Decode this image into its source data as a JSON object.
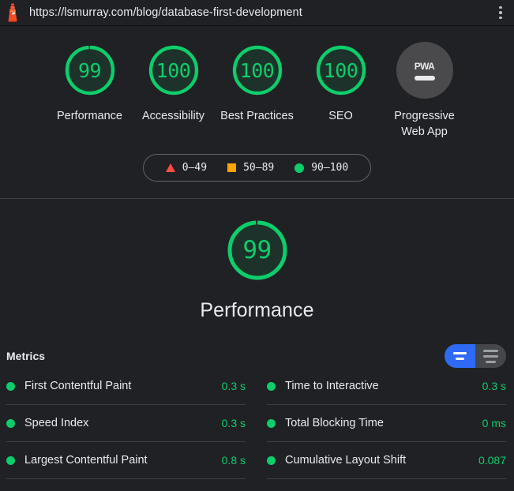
{
  "browser": {
    "url": "https://lsmurray.com/blog/database-first-development",
    "favicon_name": "lighthouse-icon",
    "menu_name": "more-options-icon"
  },
  "colors": {
    "pass": "#0CCE6B",
    "average": "#FFA400",
    "fail": "#FF4E42",
    "accent": "#2f6af5",
    "background": "#202124"
  },
  "scores": [
    {
      "value": "99",
      "label": "Performance",
      "pct": 99,
      "type": "gauge"
    },
    {
      "value": "100",
      "label": "Accessibility",
      "pct": 100,
      "type": "gauge"
    },
    {
      "value": "100",
      "label": "Best Practices",
      "pct": 100,
      "type": "gauge"
    },
    {
      "value": "100",
      "label": "SEO",
      "pct": 100,
      "type": "gauge"
    },
    {
      "value": "PWA",
      "label": "Progressive Web App",
      "pct": 0,
      "type": "badge"
    }
  ],
  "legend": {
    "items": [
      {
        "shape": "triangle",
        "range": "0—49",
        "color": "#FF4E42"
      },
      {
        "shape": "square",
        "range": "50—89",
        "color": "#FFA400"
      },
      {
        "shape": "circle",
        "range": "90—100",
        "color": "#0CCE6B"
      }
    ]
  },
  "hero": {
    "score": "99",
    "pct": 99,
    "title": "Performance"
  },
  "metrics": {
    "title": "Metrics",
    "toggle": {
      "active_name": "view-simple-toggle",
      "inactive_name": "view-detailed-toggle"
    },
    "left": [
      {
        "name": "First Contentful Paint",
        "value": "0.3 s",
        "status": "pass"
      },
      {
        "name": "Speed Index",
        "value": "0.3 s",
        "status": "pass"
      },
      {
        "name": "Largest Contentful Paint",
        "value": "0.8 s",
        "status": "pass"
      }
    ],
    "right": [
      {
        "name": "Time to Interactive",
        "value": "0.3 s",
        "status": "pass"
      },
      {
        "name": "Total Blocking Time",
        "value": "0 ms",
        "status": "pass"
      },
      {
        "name": "Cumulative Layout Shift",
        "value": "0.087",
        "status": "pass"
      }
    ]
  }
}
